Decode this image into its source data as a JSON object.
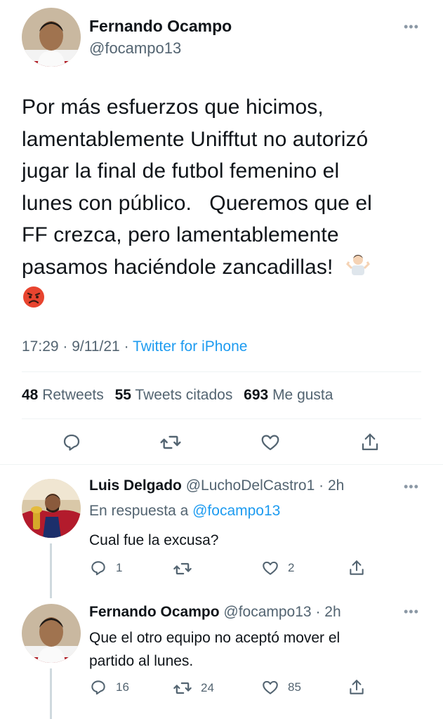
{
  "main_tweet": {
    "author_name": "Fernando Ocampo",
    "author_handle": "@focampo13",
    "text_lines": [
      "Por más esfuerzos que hicimos,",
      "lamentablemente Unifftut no autorizó",
      "jugar la final de futbol femenino el",
      "lunes con público.   Queremos que el",
      "FF crezca, pero lamentablemente",
      "pasamos haciéndole zancadillas!"
    ],
    "emojis": [
      "person-shrugging-emoji",
      "angry-face-emoji"
    ],
    "time": "17:29",
    "date": "9/11/21",
    "source": "Twitter for iPhone",
    "stats": {
      "retweets_count": "48",
      "retweets_label": "Retweets",
      "quotes_count": "55",
      "quotes_label": "Tweets citados",
      "likes_count": "693",
      "likes_label": "Me gusta"
    }
  },
  "replies": [
    {
      "author_name": "Luis Delgado",
      "author_handle": "@LuchoDelCastro1",
      "time": "2h",
      "reply_to_label": "En respuesta a",
      "reply_to_handle": "@focampo13",
      "text_lines": [
        "Cual fue la excusa?"
      ],
      "reply_count": "1",
      "retweet_count": "",
      "like_count": "2"
    },
    {
      "author_name": "Fernando Ocampo",
      "author_handle": "@focampo13",
      "time": "2h",
      "text_lines": [
        "Que el otro equipo no aceptó mover el",
        "partido al lunes."
      ],
      "reply_count": "16",
      "retweet_count": "24",
      "like_count": "85"
    }
  ],
  "colors": {
    "text": "#0f1419",
    "secondary": "#536471",
    "link": "#1d9bf0",
    "divider": "#eff3f4"
  }
}
